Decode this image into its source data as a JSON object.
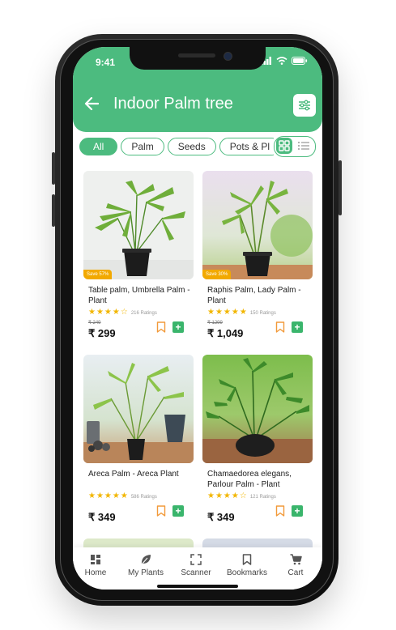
{
  "status_bar": {
    "time": "9:41"
  },
  "header": {
    "title": "Indoor Palm tree"
  },
  "chips": [
    "All",
    "Palm",
    "Seeds",
    "Pots & Pl"
  ],
  "products": [
    {
      "name": "Table palm, Umbrella Palm - Plant",
      "rating": 4,
      "ratings_count": "216 Ratings",
      "original_price": "₹ 249",
      "price": "₹ 299",
      "save": "Save 57%"
    },
    {
      "name": "Raphis Palm, Lady Palm - Plant",
      "rating": 5,
      "ratings_count": "150 Ratings",
      "original_price": "₹ 1299",
      "price": "₹ 1,049",
      "save": "Save 30%"
    },
    {
      "name": "Areca Palm - Areca Plant",
      "rating": 5,
      "ratings_count": "586 Ratings",
      "original_price": "",
      "price": "₹ 349",
      "save": ""
    },
    {
      "name": "Chamaedorea elegans, Parlour Palm - Plant",
      "rating": 4,
      "ratings_count": "121 Ratings",
      "original_price": "",
      "price": "₹ 349",
      "save": ""
    }
  ],
  "bottom_nav": [
    {
      "label": "Home",
      "icon": "home-icon"
    },
    {
      "label": "My Plants",
      "icon": "leaf-icon"
    },
    {
      "label": "Scanner",
      "icon": "scanner-icon"
    },
    {
      "label": "Bookmarks",
      "icon": "bookmark-icon"
    },
    {
      "label": "Cart",
      "icon": "cart-icon"
    }
  ],
  "colors": {
    "accent": "#4cbb7f",
    "star": "#f2b600",
    "save_badge": "#f2a900",
    "add_button": "#3ab56c",
    "bookmark": "#f29a3a"
  }
}
